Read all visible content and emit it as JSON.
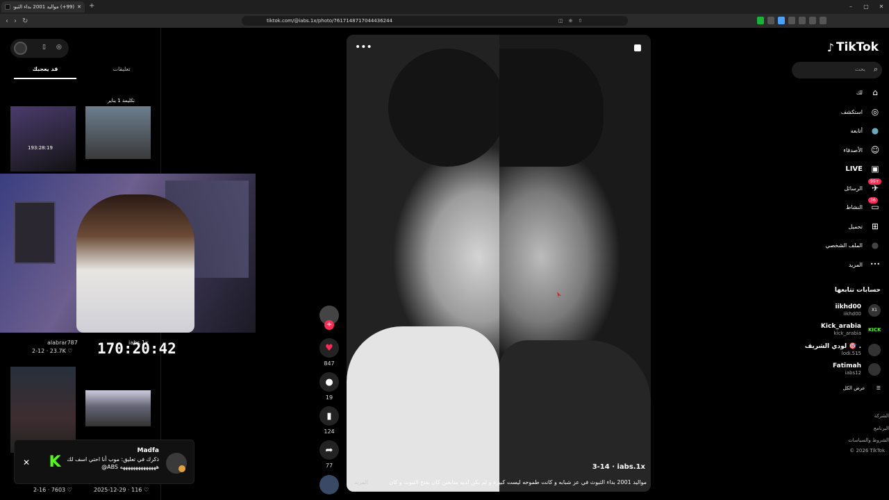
{
  "browser": {
    "tab_title": "(99+) موالید 2001 بداء الثبوث في",
    "new_tab": "+",
    "url": "tiktok.com/@iabs.1x/photo/7617148717044436244",
    "controls": {
      "minimize": "–",
      "maximize": "▢",
      "close": "✕"
    }
  },
  "stream": {
    "tabs": {
      "liked": "قد يعجبك",
      "comments": "تعليقات"
    },
    "thumb1_caption": "193:28:19",
    "thumb2_caption": "تكليمة 1 يناير",
    "thumb3": {
      "user": "alabrar787",
      "stats": "2-12 · 23.7K ♡"
    },
    "thumb4": {
      "user": "iabs.1x"
    },
    "timer": "170:20:42",
    "thumb5": {
      "stats": "2-16 · 7603 ♡"
    },
    "thumb6": {
      "stats": "2025-12-29 · 116 ♡"
    }
  },
  "toast": {
    "close": "✕",
    "logo": "K",
    "name": "Madfa",
    "message": "ذكرك في تعليق: موب أنا احتي اسف لك ههههههههههههههه ABS@"
  },
  "post": {
    "more": "•••",
    "author": "iabs.1x",
    "date": "3-14",
    "caption": "موالید 2001 بداء الثبوث في عز شبابه و كانت طموحه ليست كبيرة و لم يكن لديه متابعين كان يفتح الثبوث و كان",
    "see_more": "المزيد"
  },
  "actions": {
    "likes": "847",
    "comments": "19",
    "saves": "124",
    "shares": "77",
    "plus": "+"
  },
  "sidebar": {
    "brand": "TikTok",
    "search_placeholder": "بحث",
    "menu": [
      {
        "label": "لك",
        "icon": "home-icon",
        "glyph": "⌂"
      },
      {
        "label": "استكشف",
        "icon": "compass-icon",
        "glyph": "◎"
      },
      {
        "label": "أتابعه",
        "icon": "following-avatar-icon",
        "glyph": "●"
      },
      {
        "label": "الأصدقاء",
        "icon": "friends-icon",
        "glyph": "☺"
      },
      {
        "label": "LIVE",
        "icon": "live-icon",
        "glyph": "▣"
      },
      {
        "label": "الرسائل",
        "icon": "messages-icon",
        "glyph": "✈",
        "badge": "99+"
      },
      {
        "label": "النشاط",
        "icon": "activity-icon",
        "glyph": "▭",
        "badge": "36"
      },
      {
        "label": "تحميل",
        "icon": "upload-icon",
        "glyph": "⊞"
      },
      {
        "label": "الملف الشخصي",
        "icon": "profile-icon",
        "glyph": "●"
      },
      {
        "label": "المزيد",
        "icon": "more-icon",
        "glyph": "•••"
      }
    ],
    "following_title": "حسابات تتابعها",
    "accounts": [
      {
        "name": "iikhd00",
        "handle": "iikhd00",
        "avatar": "X1"
      },
      {
        "name": "Kick_arabia",
        "handle": "kick_arabia",
        "avatar": "KICK"
      },
      {
        "name": "لودي الشريف 🎯 .",
        "handle": "lodi.515",
        "avatar": ""
      },
      {
        "name": "Fatimah",
        "handle": "iabs12",
        "avatar": ""
      }
    ],
    "see_all": "عرض الكل",
    "see_all_icon": "☰",
    "footer": [
      "الشركة",
      "البرنامج",
      "الشروط والسياسات",
      "© 2026 TikTok"
    ]
  }
}
